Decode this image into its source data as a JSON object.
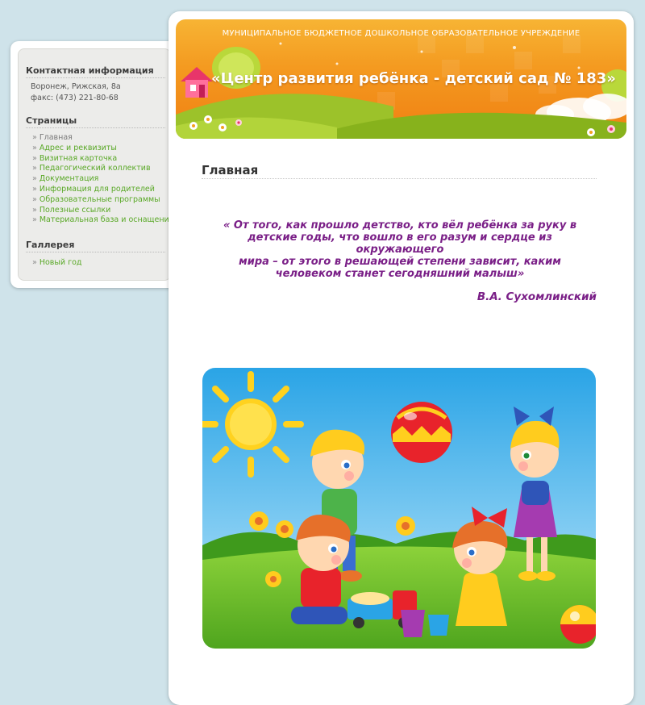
{
  "sidebar": {
    "contacts": {
      "title": "Контактная информация",
      "address": "Воронеж, Рижская, 8а",
      "fax": "факс: (473) 221-80-68"
    },
    "pages": {
      "title": "Страницы",
      "items": [
        {
          "label": "Главная",
          "current": true
        },
        {
          "label": "Адрес и реквизиты"
        },
        {
          "label": "Визитная карточка"
        },
        {
          "label": "Педагогический коллектив"
        },
        {
          "label": "Документация"
        },
        {
          "label": "Информация для родителей"
        },
        {
          "label": "Образовательные программы"
        },
        {
          "label": "Полезные ссылки"
        },
        {
          "label": "Материальная база и оснащение"
        }
      ]
    },
    "gallery": {
      "title": "Галлерея",
      "items": [
        {
          "label": "Новый год"
        }
      ]
    },
    "bullet": "»"
  },
  "header": {
    "org": "МУНИЦИПАЛЬНОЕ БЮДЖЕТНОЕ ДОШКОЛЬНОЕ ОБРАЗОВАТЕЛЬНОЕ УЧРЕЖДЕНИЕ",
    "title": "«Центр развития ребёнка - детский сад № 183»"
  },
  "main": {
    "page_title": "Главная",
    "quote_lines": [
      "« От того, как прошло детство, кто вёл ребёнка за руку в",
      "детские годы, что вошло в его разум и сердце из окружающего",
      "мира – от этого в решающей степени зависит, каким",
      "человеком станет сегодняшний малыш»"
    ],
    "author": "В.А. Сухомлинский"
  },
  "colors": {
    "background": "#cfe3ea",
    "link": "#59a826",
    "quote": "#7a1f87",
    "banner": "#f49a20"
  }
}
